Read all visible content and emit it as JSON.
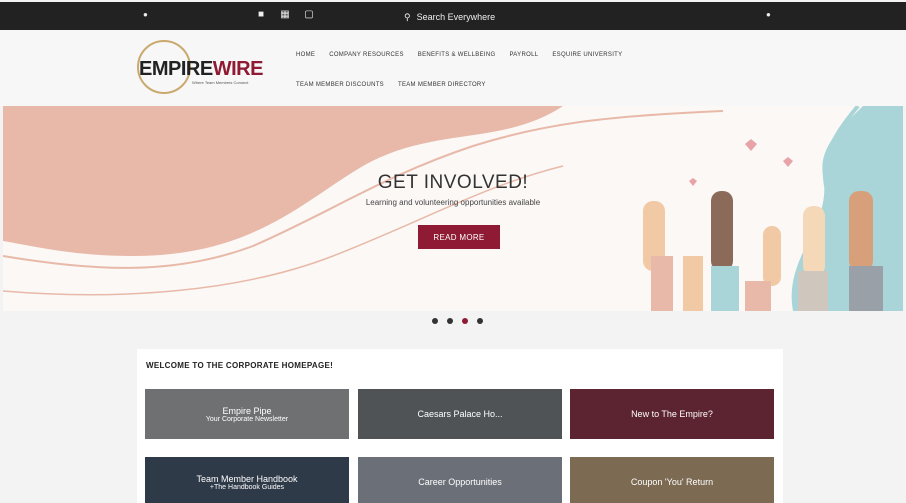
{
  "topbar": {
    "search_label": "Search Everywhere"
  },
  "icons": {
    "topbar_left": "dot",
    "topbar_a": "bookmark-icon",
    "topbar_b": "grid-icon",
    "topbar_c": "window-icon",
    "search": "search-icon",
    "topbar_right": "dot"
  },
  "header": {
    "logo_text_a": "EMPIRE",
    "logo_text_b": "WIRE",
    "logo_tagline": "Where Team Members Connect",
    "nav_row1": [
      "HOME",
      "COMPANY RESOURCES",
      "BENEFITS & WELLBEING",
      "PAYROLL",
      "ESQUIRE UNIVERSITY"
    ],
    "nav_row2": [
      "TEAM MEMBER DISCOUNTS",
      "TEAM MEMBER DIRECTORY"
    ]
  },
  "hero": {
    "title": "GET INVOLVED!",
    "subtitle": "Learning and volunteering opportunities available",
    "button_label": "READ MORE"
  },
  "carousel": {
    "count": 4,
    "active_index": 2
  },
  "welcome": {
    "title": "WELCOME TO THE CORPORATE HOMEPAGE!",
    "tiles": [
      {
        "line1": "Empire Pipe",
        "line2": "Your Corporate Newsletter",
        "color": "#6e7072"
      },
      {
        "line1": "Caesars Palace Ho...",
        "line2": "",
        "color": "#4f5356"
      },
      {
        "line1": "New to The Empire?",
        "line2": "",
        "color": "#5c2431"
      },
      {
        "line1": "Team Member Handbook",
        "line2": "+The Handbook Guides",
        "color": "#2f3a48"
      },
      {
        "line1": "Career Opportunities",
        "line2": "",
        "color": "#6b6f77"
      },
      {
        "line1": "Coupon 'You' Return",
        "line2": "",
        "color": "#7c6a52"
      }
    ]
  },
  "colors": {
    "accent": "#8e1b33",
    "topbar": "#222222",
    "hero_peach": "#e8b9a9",
    "hero_teal": "#a9d4d8"
  }
}
